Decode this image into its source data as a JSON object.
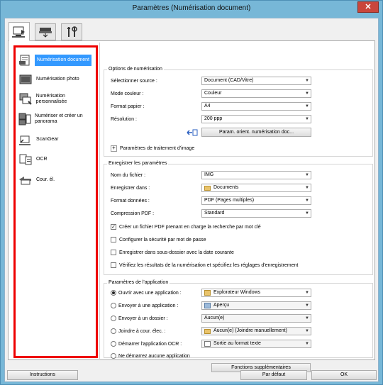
{
  "window": {
    "title": "Paramètres (Numérisation document)",
    "close_glyph": "✕"
  },
  "tabs": [
    {
      "icon": "scan-from-computer-icon"
    },
    {
      "icon": "scan-from-panel-icon"
    },
    {
      "icon": "tools-icon"
    }
  ],
  "sidebar": {
    "items": [
      {
        "label": "Numérisation document",
        "icon": "document-scan-icon",
        "selected": true
      },
      {
        "label": "Numérisation photo",
        "icon": "photo-scan-icon"
      },
      {
        "label": "Numérisation personnalisée",
        "icon": "custom-scan-icon"
      },
      {
        "label": "Numériser et créer un panorama",
        "icon": "panorama-icon"
      },
      {
        "label": "ScanGear",
        "icon": "scangear-icon"
      },
      {
        "label": "OCR",
        "icon": "ocr-icon"
      },
      {
        "label": "Cour. él.",
        "icon": "email-icon"
      }
    ]
  },
  "scan_options": {
    "title": "Options de numérisation",
    "source_label": "Sélectionner source :",
    "source_value": "Document (CAD/Vitre)",
    "color_label": "Mode couleur :",
    "color_value": "Couleur",
    "paper_label": "Format papier :",
    "paper_value": "A4",
    "resolution_label": "Résolution :",
    "resolution_value": "200 ppp",
    "orientation_button": "Param. orient. numérisation doc...",
    "image_processing": "Paramètres de traitement d'image"
  },
  "save_settings": {
    "title": "Enregistrer les paramètres",
    "filename_label": "Nom du fichier :",
    "filename_value": "IMG",
    "savein_label": "Enregistrer dans :",
    "savein_value": "Documents",
    "format_label": "Format données :",
    "format_value": "PDF (Pages multiples)",
    "compression_label": "Compression PDF :",
    "compression_value": "Standard",
    "checks": [
      {
        "label": "Créer un fichier PDF prenant en charge la recherche par mot clé",
        "checked": true
      },
      {
        "label": "Configurer la sécurité par mot de passe",
        "checked": false
      },
      {
        "label": "Enregistrer dans sous-dossier avec la date courante",
        "checked": false
      },
      {
        "label": "Vérifiez les résultats de la numérisation et spécifiez les réglages d'enregistrement",
        "checked": false
      }
    ]
  },
  "app_settings": {
    "title": "Paramètres de l'application",
    "options": [
      {
        "label": "Ouvrir avec une application :",
        "value": "Explorateur Windows",
        "selected": true,
        "enabled": true
      },
      {
        "label": "Envoyer à une application :",
        "value": "Aperçu",
        "selected": false,
        "enabled": false
      },
      {
        "label": "Envoyer à un dossier :",
        "value": "Aucun(e)",
        "selected": false,
        "enabled": false
      },
      {
        "label": "Joindre à cour. élec. :",
        "value": "Aucun(e) (Joindre manuellement)",
        "selected": false,
        "enabled": false
      },
      {
        "label": "Démarrer l'application OCR :",
        "value": "Sortie au format texte",
        "selected": false,
        "enabled": false
      },
      {
        "label": "Ne démarrez aucune application",
        "selected": false
      }
    ],
    "more_button": "Fonctions supplémentaires"
  },
  "footer": {
    "instructions": "Instructions",
    "default": "Par défaut",
    "ok": "OK"
  }
}
